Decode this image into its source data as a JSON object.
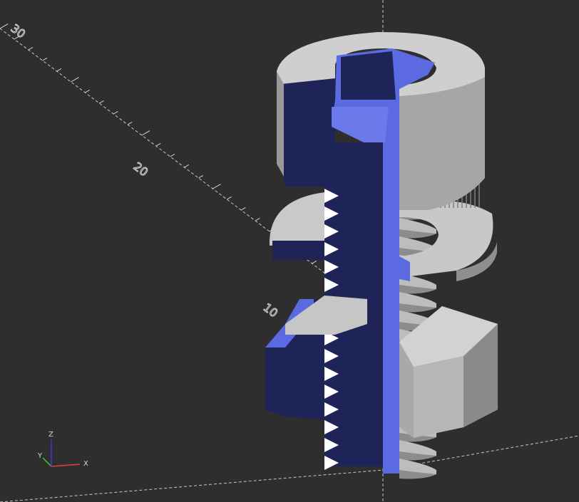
{
  "viewport": {
    "background": "#2e2e2e",
    "axis_labels": [
      "30",
      "20",
      "10"
    ],
    "gizmo": {
      "x_label": "X",
      "y_label": "Y",
      "z_label": "Z"
    }
  },
  "colors": {
    "cut_face": "#5b6ae0",
    "cut_shadow": "#1e2458",
    "metal_light": "#d2d2d2",
    "metal_mid": "#a9a9a9",
    "metal_dark": "#7b7b7b",
    "axis_x": "#e53c3c",
    "axis_y": "#3cc83c",
    "axis_z": "#3c3cd8",
    "grid": "#d8d8d8"
  },
  "model": {
    "parts": [
      "cap-screw-head",
      "washer",
      "hex-nut",
      "threaded-shank"
    ],
    "cross_section": true
  }
}
